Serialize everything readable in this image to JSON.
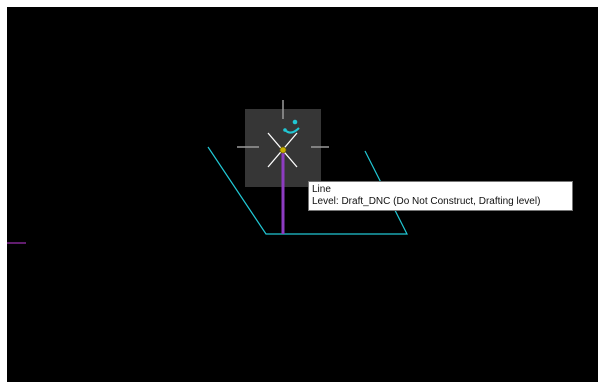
{
  "tooltip": {
    "title": "Line",
    "detail": "Level: Draft_DNC (Do Not Construct, Drafting level)"
  },
  "colors": {
    "canvas_background": "#000000",
    "cyan_element": "#21c7d4",
    "magenta_line": "#9b2fb0",
    "purple_line": "#8e3cc2",
    "crosshair": "#8a8a8a",
    "snap_box": "#4a4a4a",
    "highlight": "#ffffff",
    "snap_point": "#c8b000"
  },
  "icons": {
    "snap_cursor": "snap-cursor-icon",
    "rotate_handle": "rotate-handle-icon"
  }
}
